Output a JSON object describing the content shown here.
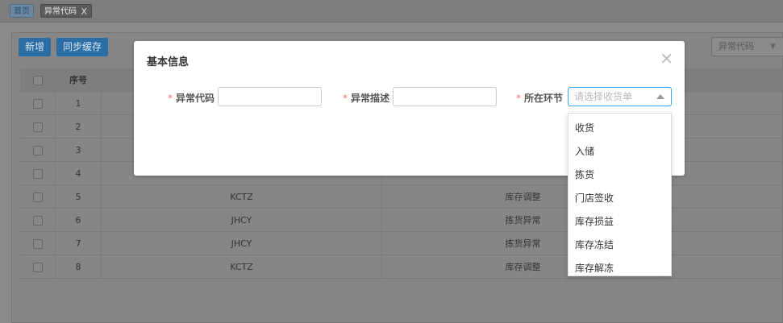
{
  "tabs": {
    "home": "首页",
    "active": "异常代码",
    "close": "X"
  },
  "toolbar": {
    "add_label": "新增",
    "sync_label": "同步缓存",
    "filter_value": "异常代码"
  },
  "grid": {
    "headers": {
      "no": "序号"
    },
    "rows": [
      {
        "no": "1",
        "code": "",
        "desc": ""
      },
      {
        "no": "2",
        "code": "",
        "desc": ""
      },
      {
        "no": "3",
        "code": "",
        "desc": ""
      },
      {
        "no": "4",
        "code": "",
        "desc": ""
      },
      {
        "no": "5",
        "code": "KCTZ",
        "desc": "库存调整"
      },
      {
        "no": "6",
        "code": "JHCY",
        "desc": "拣货异常"
      },
      {
        "no": "7",
        "code": "JHCY",
        "desc": "拣货异常"
      },
      {
        "no": "8",
        "code": "KCTZ",
        "desc": "库存调整"
      }
    ]
  },
  "modal": {
    "title": "基本信息",
    "close": "×",
    "required_mark": "*",
    "fields": {
      "code_label": "异常代码",
      "desc_label": "异常描述",
      "stage_label": "所在环节",
      "stage_placeholder": "请选择收货单"
    },
    "stage_options": [
      "收货",
      "入储",
      "拣货",
      "门店签收",
      "库存损益",
      "库存冻结",
      "库存解冻"
    ]
  },
  "colors": {
    "primary": "#409eff",
    "required": "#f56c6c",
    "overlay": "#8a8a8a"
  }
}
